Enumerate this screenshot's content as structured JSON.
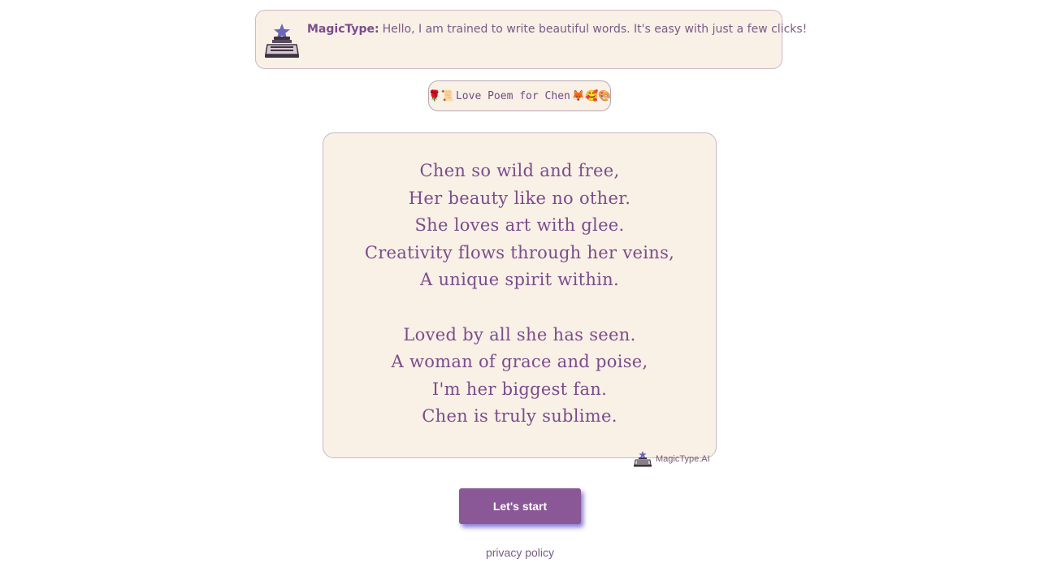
{
  "intro": {
    "brand": "MagicType:",
    "message": "Hello, I am trained to write beautiful words. It's easy with just a few clicks!",
    "icon": "typewriter-star-icon"
  },
  "title_pill": {
    "leading_emojis": "🌹📜",
    "label": "Love Poem for Chen",
    "trailing_emojis": "🦊🥰🎨"
  },
  "poem": {
    "stanza_1": [
      "Chen so wild and free,",
      "Her beauty like no other.",
      "She loves art with glee.",
      "Creativity flows through her veins,",
      "A unique spirit within."
    ],
    "stanza_2": [
      "Loved by all she has seen.",
      "A woman of grace and poise,",
      "I'm her biggest fan.",
      "Chen is truly sublime."
    ]
  },
  "watermark": {
    "label": "MagicType.AI",
    "icon": "typewriter-icon"
  },
  "start_button": {
    "label": "Let's start"
  },
  "privacy_link": {
    "label": "privacy policy"
  },
  "colors": {
    "accent": "#8a5896",
    "card_background": "#f9f0e6",
    "text": "#7a4d8b",
    "button_glow": "#5c4ec8"
  }
}
